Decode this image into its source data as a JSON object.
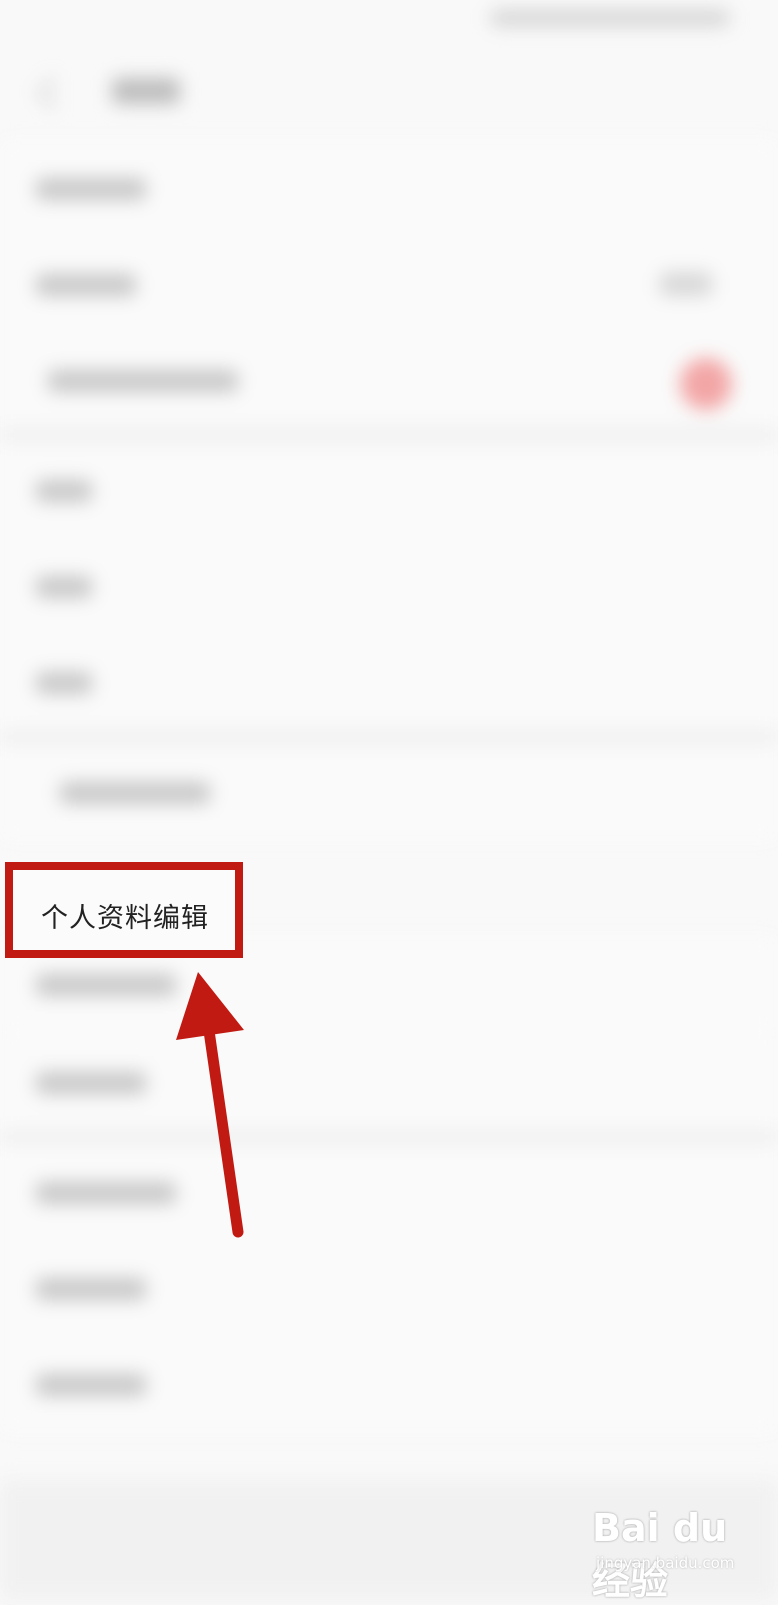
{
  "highlight": {
    "label": "个人资料编辑"
  },
  "watermark": {
    "brand": "Bai du 经验",
    "domain": "jingyan.baidu.com"
  },
  "colors": {
    "highlight": "#c11a12",
    "background": "#f9f9f9"
  }
}
